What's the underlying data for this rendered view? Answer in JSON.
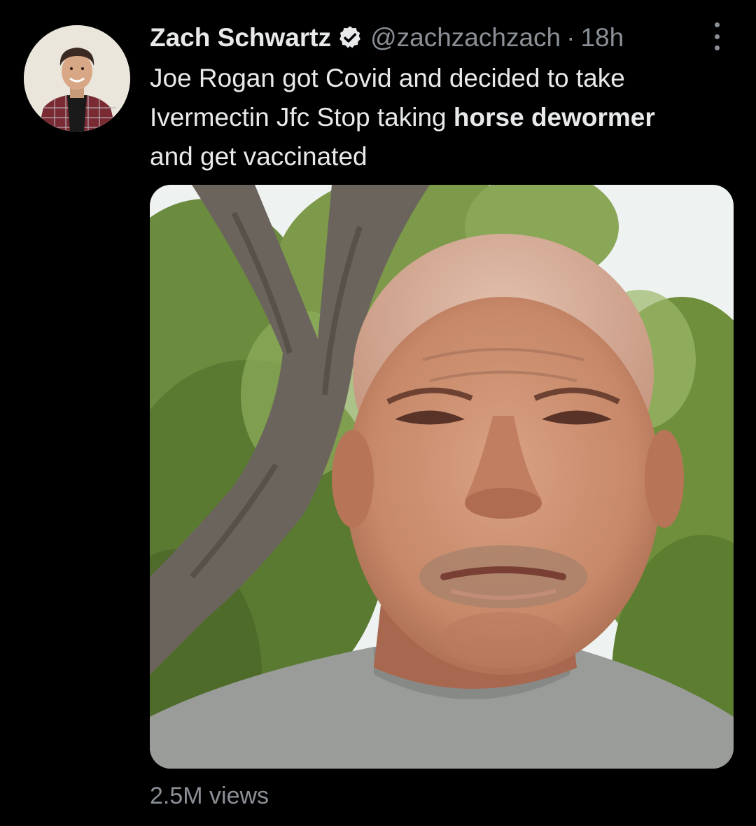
{
  "tweet": {
    "display_name": "Zach Schwartz",
    "verified_icon": "verified-badge-icon",
    "handle": "@zachzachzach",
    "separator": "·",
    "time": "18h",
    "more_icon": "more-vertical-icon",
    "text_part1": "Joe Rogan got Covid and decided to take",
    "text_part2": "Ivermectin Jfc Stop taking ",
    "text_bold": "horse dewormer",
    "text_part3": "and get vaccinated",
    "views": "2.5M views"
  },
  "colors": {
    "background": "#000000",
    "primary_text": "#e7e9ea",
    "secondary_text": "#8b9097"
  }
}
